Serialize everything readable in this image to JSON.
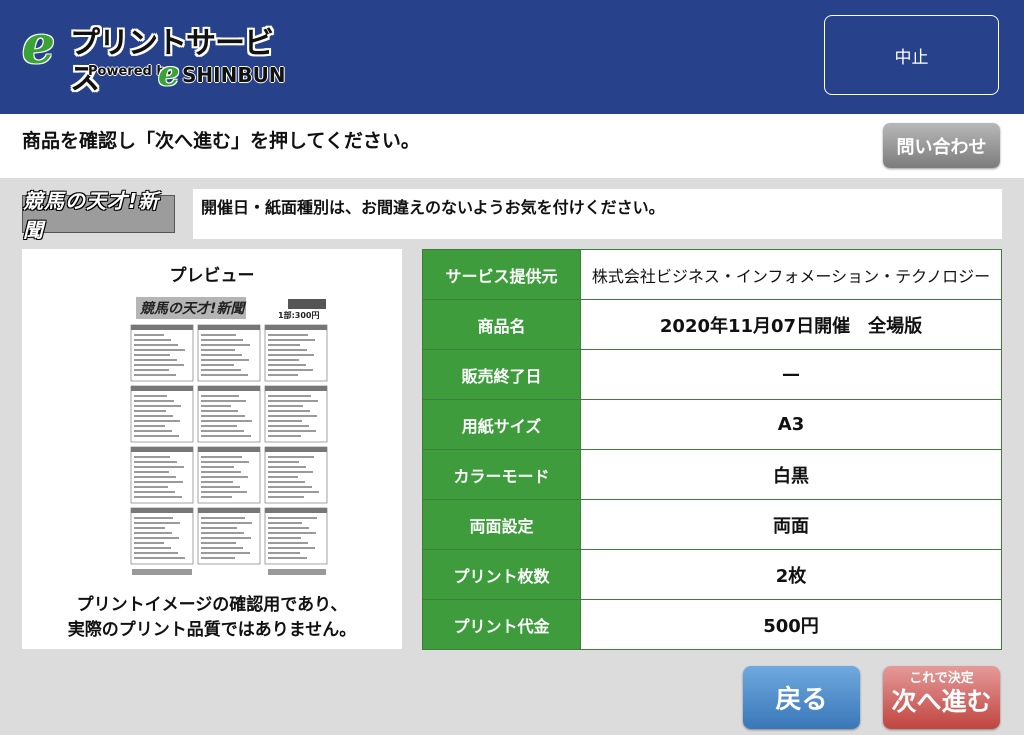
{
  "header": {
    "logo": {
      "e_mark": "e",
      "title": "プリントサービス",
      "powered_by": "Powered by",
      "e_mark2": "e",
      "brand": "SHINBUN"
    },
    "cancel_label": "中止",
    "color": "#27428a"
  },
  "instruction": {
    "text": "商品を確認し「次へ進む」を押してください。",
    "contact_label": "問い合わせ"
  },
  "notice": {
    "paper_logo": "競馬の天才!新聞",
    "text": "開催日・紙面種別は、お間違えのないようお気を付けください。"
  },
  "preview": {
    "title": "プレビュー",
    "caption_line1": "プリントイメージの確認用であり、",
    "caption_line2": "実際のプリント品質ではありません。",
    "page_header": "競馬の天才!新聞",
    "page_price": "1部:300円"
  },
  "info_table": [
    {
      "label": "サービス提供元",
      "value": "株式会社ビジネス・インフォメーション・テクノロジー"
    },
    {
      "label": "商品名",
      "value": "2020年11月07日開催　全場版"
    },
    {
      "label": "販売終了日",
      "value": "—"
    },
    {
      "label": "用紙サイズ",
      "value": "A3"
    },
    {
      "label": "カラーモード",
      "value": "白黒"
    },
    {
      "label": "両面設定",
      "value": "両面"
    },
    {
      "label": "プリント枚数",
      "value": "2枚"
    },
    {
      "label": "プリント代金",
      "value": "500円"
    }
  ],
  "buttons": {
    "back_label": "戻る",
    "next_sub": "これで決定",
    "next_main": "次へ進む"
  },
  "colors": {
    "label_green": "#3f9c3d",
    "back_blue": "#3977b8",
    "next_red": "#c0453f",
    "contact_gray": "#8a8a8a"
  }
}
